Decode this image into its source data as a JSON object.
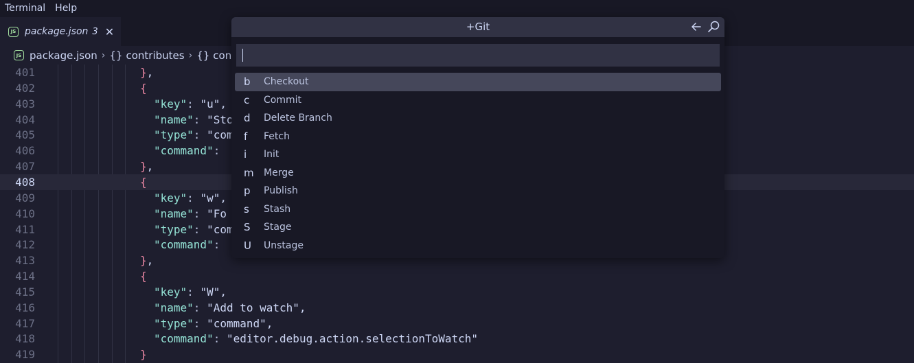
{
  "menubar": {
    "items": [
      "Terminal",
      "Help"
    ]
  },
  "tab": {
    "file_label": "package.json",
    "problem_count": "3",
    "close_glyph": "✕",
    "icon_text": "JS"
  },
  "breadcrumb": {
    "file": "package.json",
    "crumbs": [
      {
        "braces": "{}",
        "label": "contributes"
      },
      {
        "braces": "{}",
        "label": "conf"
      }
    ],
    "separator": "›"
  },
  "quickpick": {
    "title": "+Git",
    "input_value": "",
    "back_icon": "arrow-left-icon",
    "search_icon": "search-icon",
    "items": [
      {
        "key": "b",
        "label": "Checkout",
        "selected": true
      },
      {
        "key": "c",
        "label": "Commit"
      },
      {
        "key": "d",
        "label": "Delete Branch"
      },
      {
        "key": "f",
        "label": "Fetch"
      },
      {
        "key": "i",
        "label": "Init"
      },
      {
        "key": "m",
        "label": "Merge"
      },
      {
        "key": "p",
        "label": "Publish"
      },
      {
        "key": "s",
        "label": "Stash"
      },
      {
        "key": "S",
        "label": "Stage"
      },
      {
        "key": "U",
        "label": "Unstage"
      }
    ]
  },
  "editor": {
    "active_line": "408",
    "lines": [
      {
        "number": "401",
        "text": "},"
      },
      {
        "number": "402",
        "text": "{"
      },
      {
        "number": "403",
        "text": "\"key\": \"u\","
      },
      {
        "number": "404",
        "text": "\"name\": \"Sto"
      },
      {
        "number": "405",
        "text": "\"type\": \"com"
      },
      {
        "number": "406",
        "text": "\"command\":"
      },
      {
        "number": "407",
        "text": "},"
      },
      {
        "number": "408",
        "text": "{"
      },
      {
        "number": "409",
        "text": "\"key\": \"w\","
      },
      {
        "number": "410",
        "text": "\"name\": \"Fo"
      },
      {
        "number": "411",
        "text": "\"type\": \"com"
      },
      {
        "number": "412",
        "text": "\"command\":"
      },
      {
        "number": "413",
        "text": "},"
      },
      {
        "number": "414",
        "text": "{"
      },
      {
        "number": "415",
        "text": "\"key\": \"W\","
      },
      {
        "number": "416",
        "text": "\"name\": \"Add to watch\","
      },
      {
        "number": "417",
        "text": "\"type\": \"command\","
      },
      {
        "number": "418",
        "text": "\"command\": \"editor.debug.action.selectionToWatch\""
      },
      {
        "number": "419",
        "text": "}"
      }
    ]
  },
  "colors": {
    "background": "#1e1e2e",
    "chrome": "#181825",
    "key": "#94e2d5",
    "string": "#a6e3a1",
    "brace": "#f38ba8",
    "selection": "#45475a"
  }
}
